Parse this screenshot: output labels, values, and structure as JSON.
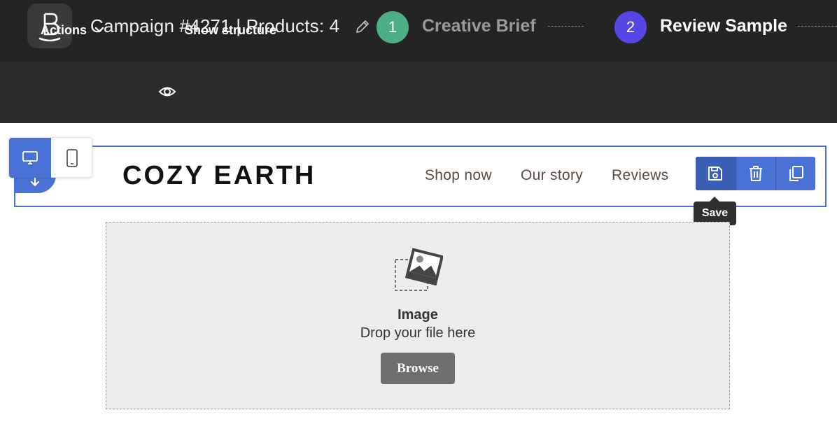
{
  "header": {
    "logo_icon": "brand-logo-icon",
    "campaign_title": "Campaign #4271 | Products: 4",
    "edit_icon": "pencil-icon",
    "steps": [
      {
        "number": "1",
        "label": "Creative Brief",
        "color": "#4caf85",
        "state": "inactive"
      },
      {
        "number": "2",
        "label": "Review Sample",
        "color": "#5646e6",
        "state": "active"
      }
    ]
  },
  "toolbar": {
    "actions_label": "Actions",
    "show_structure_label": "Show structure"
  },
  "canvas": {
    "device_modes": [
      {
        "name": "desktop",
        "icon": "monitor-icon",
        "selected": true
      },
      {
        "name": "mobile",
        "icon": "phone-icon",
        "selected": false
      }
    ],
    "email_header": {
      "brand": "COZY EARTH",
      "nav_links": [
        "Shop now",
        "Our story",
        "Reviews"
      ]
    },
    "block_tools": {
      "save_icon": "save-icon",
      "delete_icon": "trash-icon",
      "copy_icon": "copy-icon",
      "tooltip": "Save"
    },
    "image_dropzone": {
      "title": "Image",
      "subtitle": "Drop your file here",
      "button_label": "Browse"
    }
  },
  "colors": {
    "accent": "#4a72d6",
    "header_bg": "#242424",
    "toolbar_bg": "#2c2c2c"
  }
}
